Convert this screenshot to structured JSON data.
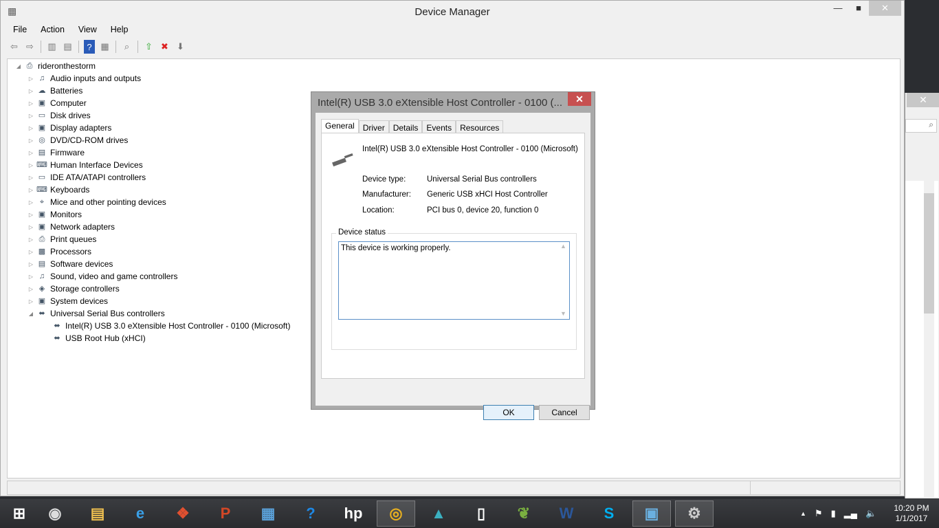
{
  "window": {
    "title": "Device Manager",
    "minimize": "—",
    "maximize": "■",
    "close": "✕"
  },
  "menu": [
    "File",
    "Action",
    "View",
    "Help"
  ],
  "toolbar": [
    {
      "icon": "back-icon",
      "g": "⇦"
    },
    {
      "icon": "forward-icon",
      "g": "⇨"
    },
    {
      "icon": "show-hide-console-tree-icon",
      "g": "▥"
    },
    {
      "icon": "properties-icon",
      "g": "▤"
    },
    {
      "icon": "help-icon",
      "g": "?"
    },
    {
      "icon": "show-hide-action-pane-icon",
      "g": "▦"
    },
    {
      "icon": "scan-hardware-icon",
      "g": "⌕"
    },
    {
      "icon": "update-driver-icon",
      "g": "⇧"
    },
    {
      "icon": "uninstall-icon",
      "g": "✖"
    },
    {
      "icon": "disable-device-icon",
      "g": "⬇"
    }
  ],
  "tree": {
    "root": "rideronthestorm",
    "categories": [
      "Audio inputs and outputs",
      "Batteries",
      "Computer",
      "Disk drives",
      "Display adapters",
      "DVD/CD-ROM drives",
      "Firmware",
      "Human Interface Devices",
      "IDE ATA/ATAPI controllers",
      "Keyboards",
      "Mice and other pointing devices",
      "Monitors",
      "Network adapters",
      "Print queues",
      "Processors",
      "Software devices",
      "Sound, video and game controllers",
      "Storage controllers",
      "System devices",
      "Universal Serial Bus controllers"
    ],
    "usb_children": [
      "Intel(R) USB 3.0 eXtensible Host Controller - 0100 (Microsoft)",
      "USB Root Hub (xHCI)"
    ]
  },
  "dialog": {
    "title": "Intel(R) USB 3.0 eXtensible Host Controller - 0100 (...",
    "close": "✕",
    "tabs": [
      "General",
      "Driver",
      "Details",
      "Events",
      "Resources"
    ],
    "device_name": "Intel(R) USB 3.0 eXtensible Host Controller - 0100 (Microsoft)",
    "device_type_label": "Device type:",
    "device_type": "Universal Serial Bus controllers",
    "manufacturer_label": "Manufacturer:",
    "manufacturer": "Generic USB xHCI Host Controller",
    "location_label": "Location:",
    "location": "PCI bus 0, device 20, function 0",
    "status_label": "Device status",
    "status_text": "This device is working properly.",
    "ok": "OK",
    "cancel": "Cancel"
  },
  "bg_window": {
    "close": "✕",
    "search_icon": "⌕"
  },
  "taskbar": {
    "time": "10:20 PM",
    "date": "1/1/2017",
    "apps": [
      {
        "name": "start-button",
        "g": "⊞",
        "c": "#fff"
      },
      {
        "name": "webcam-app",
        "g": "◉",
        "c": "#ddd"
      },
      {
        "name": "file-explorer",
        "g": "▤",
        "c": "#f0c050"
      },
      {
        "name": "internet-explorer",
        "g": "e",
        "c": "#3aa0e8"
      },
      {
        "name": "puzzle-app",
        "g": "❖",
        "c": "#e05030"
      },
      {
        "name": "powerpoint",
        "g": "P",
        "c": "#d24726"
      },
      {
        "name": "calculator",
        "g": "▦",
        "c": "#5aa0d8"
      },
      {
        "name": "help-app",
        "g": "?",
        "c": "#1e88e5"
      },
      {
        "name": "hp-app",
        "g": "hp",
        "c": "#fff"
      },
      {
        "name": "chrome",
        "g": "◎",
        "c": "#e8b020"
      },
      {
        "name": "photos-app",
        "g": "▲",
        "c": "#3bb0c0"
      },
      {
        "name": "blank-document",
        "g": "▯",
        "c": "#fff"
      },
      {
        "name": "green-app",
        "g": "❦",
        "c": "#7ab040"
      },
      {
        "name": "word",
        "g": "W",
        "c": "#2b579a"
      },
      {
        "name": "skype",
        "g": "S",
        "c": "#00aff0"
      },
      {
        "name": "control-panel",
        "g": "▣",
        "c": "#6ab0e0"
      },
      {
        "name": "device-manager",
        "g": "⚙",
        "c": "#ccc"
      }
    ]
  }
}
